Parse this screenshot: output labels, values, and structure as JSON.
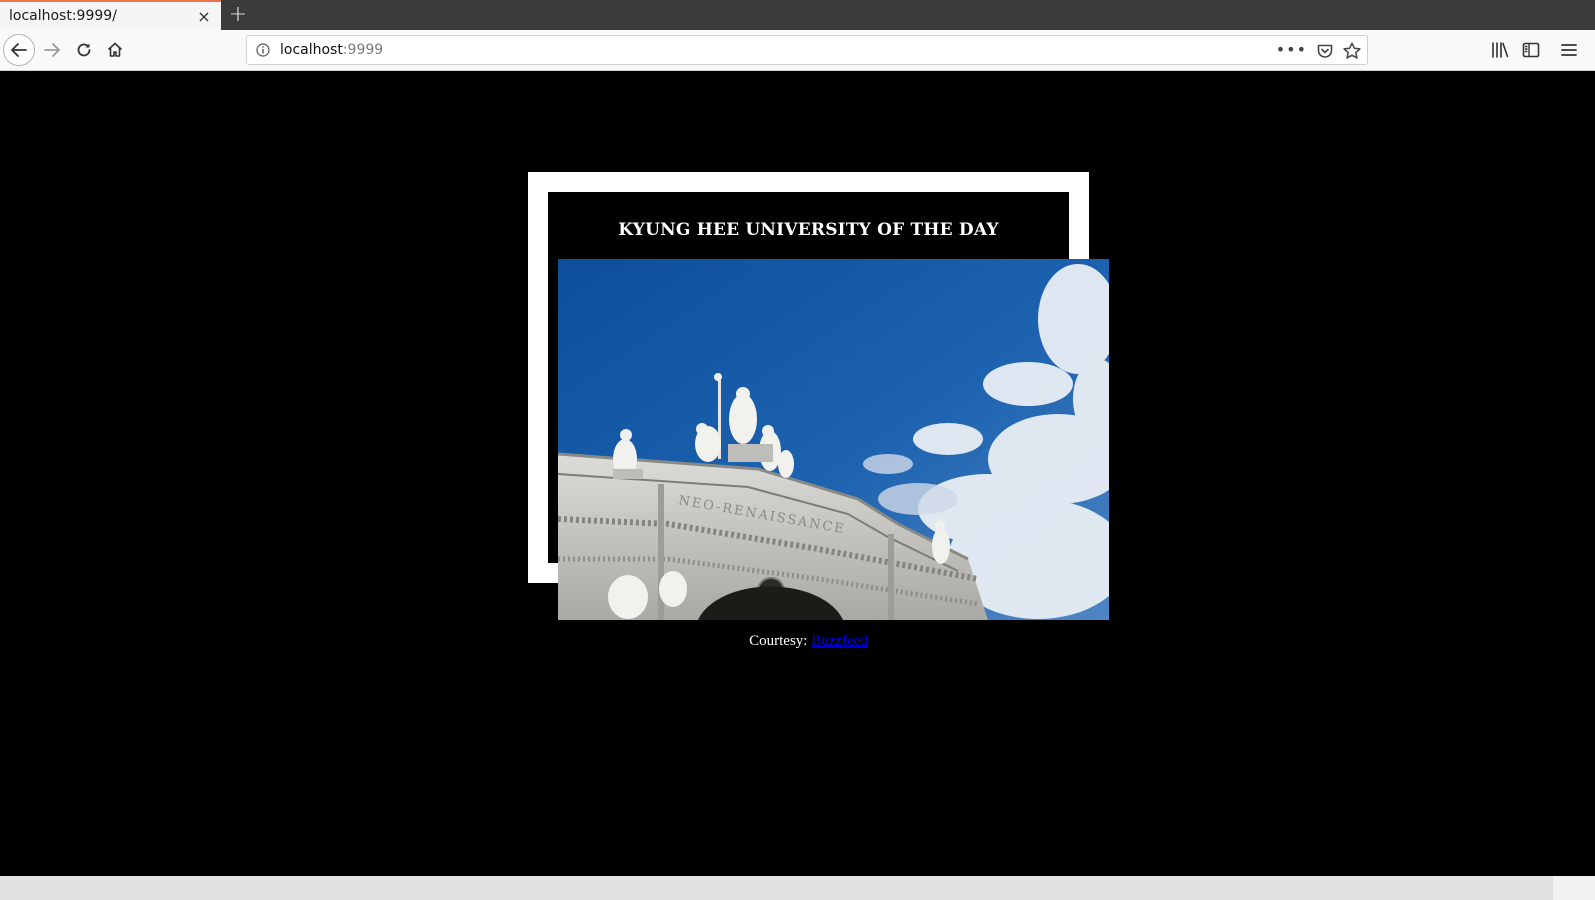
{
  "browser": {
    "tab_title": "localhost:9999/",
    "tab_close": "×",
    "new_tab": "+",
    "url_host": "localhost",
    "url_port": ":9999",
    "url_actions": "•••"
  },
  "page": {
    "heading": "KYUNG HEE UNIVERSITY OF THE DAY",
    "courtesy_label": "Courtesy:",
    "courtesy_link": "Buzzfeed",
    "photo_inscription": "NEO-RENAISSANCE"
  },
  "colors": {
    "page_background": "#000000",
    "frame": "#ffffff",
    "sky": "#1b5fae",
    "link": "#0000ee"
  },
  "icons": [
    "back-arrow-icon",
    "forward-arrow-icon",
    "reload-icon",
    "home-icon",
    "info-icon",
    "page-actions-icon",
    "pocket-icon",
    "bookmark-star-icon",
    "library-icon",
    "sidebar-icon",
    "menu-icon"
  ]
}
